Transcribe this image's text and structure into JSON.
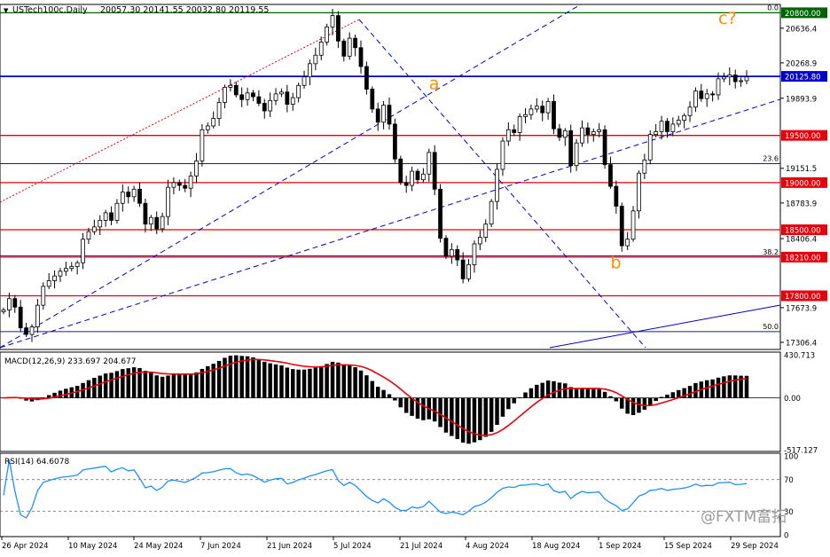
{
  "header": {
    "symbol": "USTech100c,Daily",
    "ohlc": "20057.30 20141.55 20032.80 20119.55",
    "menu_glyph": "▼"
  },
  "colors": {
    "up_fill": "#ffffff",
    "down_fill": "#000000",
    "candle_stroke": "#000000",
    "red_line": "#e8000b",
    "blue_line": "#0000cc",
    "wave_label": "#ff8c00",
    "green_tag": "#006400"
  },
  "chart_data": [
    {
      "type": "candlestick",
      "name": "price",
      "ylim": [
        17250,
        20860
      ],
      "y_ticks": [
        20636.4,
        20268.9,
        19893.9,
        19151.5,
        18783.9,
        18406.4,
        17673.9,
        17306.4
      ],
      "x_labels": [
        "26 Apr 2024",
        "10 May 2024",
        "24 May 2024",
        "7 Jun 2024",
        "21 Jun 2024",
        "5 Jul 2024",
        "21 Jul 2024",
        "4 Aug 2024",
        "18 Aug 2024",
        "1 Sep 2024",
        "15 Sep 2024",
        "29 Sep 2024"
      ],
      "closes": [
        17650,
        17770,
        17680,
        17460,
        17390,
        17470,
        17700,
        17900,
        17960,
        18010,
        18060,
        18090,
        18110,
        18150,
        18400,
        18480,
        18530,
        18600,
        18680,
        18600,
        18780,
        18900,
        18850,
        18930,
        18780,
        18560,
        18630,
        18510,
        18640,
        18950,
        19000,
        18970,
        18940,
        19070,
        19230,
        19560,
        19600,
        19680,
        19850,
        20010,
        20030,
        19930,
        19880,
        19950,
        19910,
        19840,
        19760,
        19870,
        19940,
        19960,
        19830,
        19900,
        20030,
        20120,
        20260,
        20350,
        20490,
        20650,
        20770,
        20500,
        20340,
        20530,
        20430,
        20230,
        19990,
        19780,
        19640,
        19820,
        19620,
        19250,
        19000,
        18970,
        19120,
        19030,
        19090,
        19320,
        18930,
        18410,
        18220,
        18290,
        18180,
        17980,
        18130,
        18350,
        18420,
        18560,
        18800,
        19140,
        19440,
        19560,
        19530,
        19700,
        19720,
        19780,
        19810,
        19740,
        19860,
        19570,
        19480,
        19550,
        19180,
        19420,
        19580,
        19510,
        19540,
        19560,
        19190,
        18960,
        18750,
        18330,
        18400,
        18700,
        19100,
        19240,
        19510,
        19540,
        19650,
        19540,
        19620,
        19660,
        19710,
        19800,
        19970,
        19890,
        19940,
        19930,
        20100,
        20120,
        20140,
        20070,
        20080,
        20119.55
      ],
      "candles_drawn": 132,
      "levels": [
        {
          "value": 20800,
          "label": "20800.00",
          "kind": "fib_top",
          "fib_text": "0.0"
        },
        {
          "value": 20125.8,
          "label": "20125.80",
          "kind": "blue"
        },
        {
          "value": 19500,
          "label": "19500.00",
          "kind": "red"
        },
        {
          "value": 19201,
          "label": "",
          "kind": "fib",
          "fib_text": "23.6"
        },
        {
          "value": 19000,
          "label": "19000.00",
          "kind": "red"
        },
        {
          "value": 18500,
          "label": "18500.00",
          "kind": "red"
        },
        {
          "value": 18210,
          "label": "18210.00",
          "kind": "red_fib",
          "fib_text": "38.2"
        },
        {
          "value": 17800,
          "label": "17800.00",
          "kind": "red"
        },
        {
          "value": 17420,
          "label": "",
          "kind": "fib",
          "fib_text": "50.0"
        }
      ],
      "wave_labels": [
        {
          "text": "a",
          "bar": 75,
          "value": 19990
        },
        {
          "text": "b",
          "bar": 107,
          "value": 18090
        },
        {
          "text": "c?",
          "bar": 126,
          "value": 20680
        }
      ]
    },
    {
      "type": "bar",
      "name": "MACD(12,26,9)",
      "label_text": "MACD(12,26,9) 233.697 204.677",
      "y_ticks": [
        430.713,
        0.0,
        -517.127
      ],
      "ylim": [
        -517.127,
        430.713
      ]
    },
    {
      "type": "line",
      "name": "RSI(14)",
      "label_text": "RSI(14) 64.6078",
      "y_ticks": [
        100,
        70,
        30,
        0
      ],
      "ylim": [
        0,
        100
      ]
    }
  ],
  "watermark": {
    "text": "@FXTM富拓"
  }
}
